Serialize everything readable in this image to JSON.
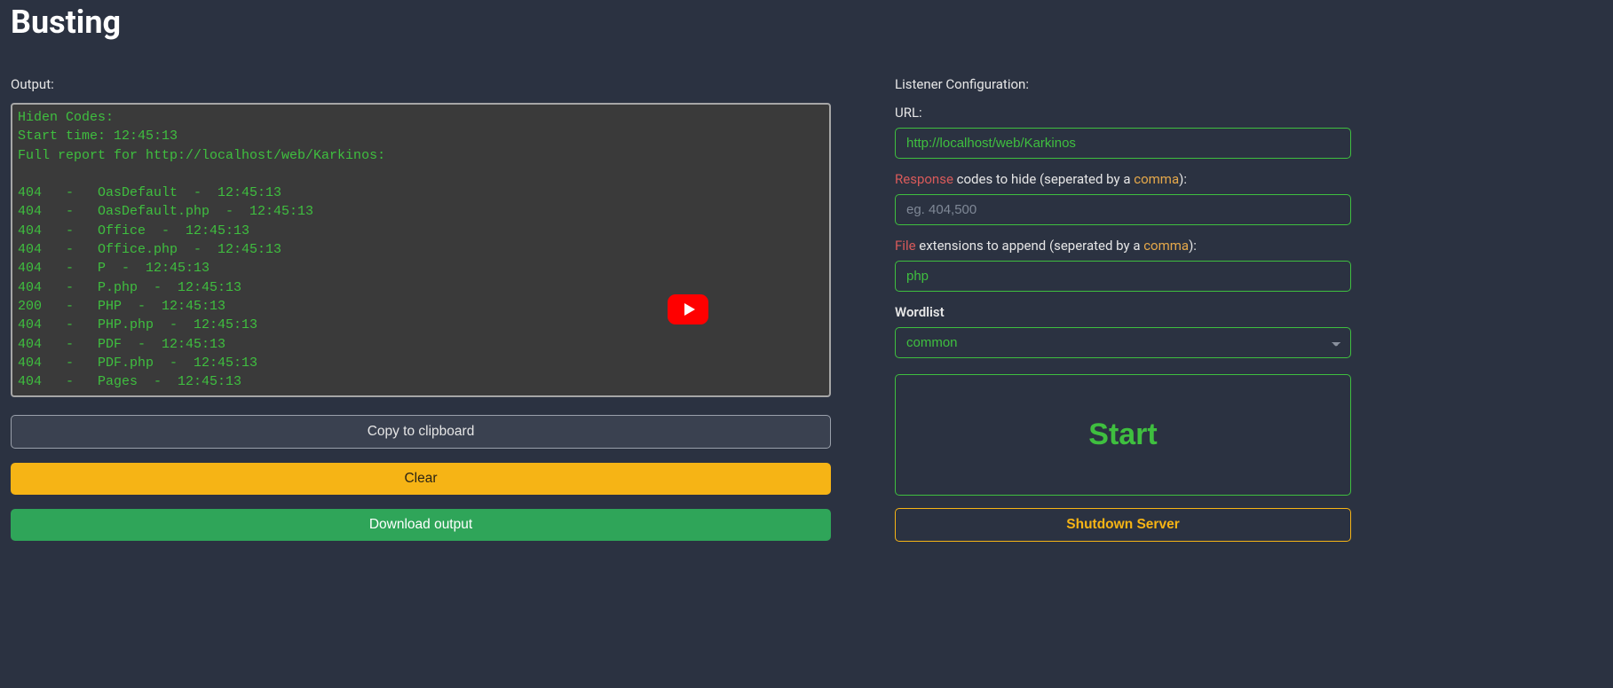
{
  "title": "Busting",
  "left": {
    "output_label": "Output:",
    "output_lines": [
      "Hiden Codes:",
      "Start time: 12:45:13",
      "Full report for http://localhost/web/Karkinos:",
      "",
      "404   -   OasDefault  -  12:45:13",
      "404   -   OasDefault.php  -  12:45:13",
      "404   -   Office  -  12:45:13",
      "404   -   Office.php  -  12:45:13",
      "404   -   P  -  12:45:13",
      "404   -   P.php  -  12:45:13",
      "200   -   PHP  -  12:45:13",
      "404   -   PHP.php  -  12:45:13",
      "404   -   PDF  -  12:45:13",
      "404   -   PDF.php  -  12:45:13",
      "404   -   Pages  -  12:45:13"
    ],
    "copy_label": "Copy to clipboard",
    "clear_label": "Clear",
    "download_label": "Download output"
  },
  "right": {
    "config_label": "Listener Configuration:",
    "url_label": "URL:",
    "url_value": "http://localhost/web/Karkinos",
    "response_label_parts": {
      "accent": "Response",
      "rest": " codes to hide (seperated by a ",
      "accent2": "comma",
      "tail": "):"
    },
    "response_placeholder": "eg. 404,500",
    "response_value": "",
    "file_label_parts": {
      "accent": "File",
      "rest": " extensions to append (seperated by a ",
      "accent2": "comma",
      "tail": "):"
    },
    "file_value": "php",
    "wordlist_label": "Wordlist",
    "wordlist_selected": "common",
    "start_label": "Start",
    "shutdown_label": "Shutdown Server"
  }
}
